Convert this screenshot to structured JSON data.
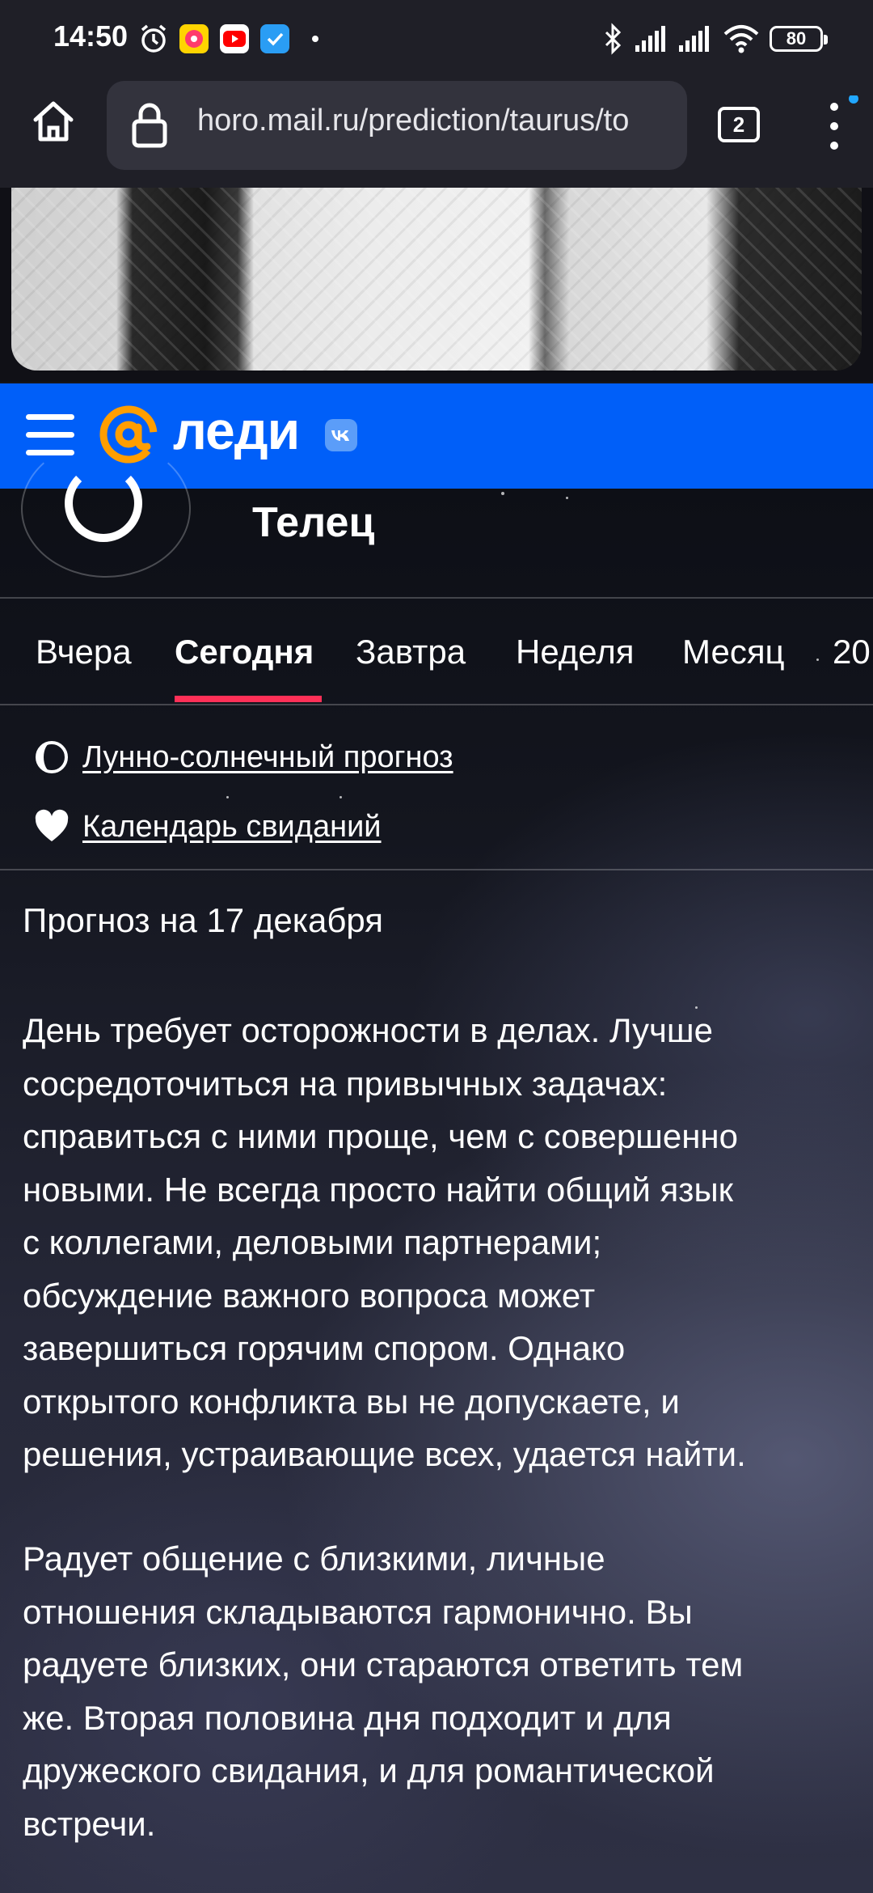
{
  "status_bar": {
    "time": "14:50",
    "battery": "80",
    "icons": [
      "alarm-icon",
      "music-app-icon",
      "youtube-icon",
      "task-app-icon",
      "dot-icon",
      "bluetooth-icon",
      "signal-icon",
      "signal-icon",
      "wifi-icon",
      "battery-icon"
    ]
  },
  "browser": {
    "url": "horo.mail.ru/prediction/taurus/to",
    "tab_count": "2"
  },
  "site_header": {
    "logo_text": "леди",
    "brand_color": "#005ff9"
  },
  "sign": {
    "title": "Телец"
  },
  "tabs": [
    {
      "label": "Вчера"
    },
    {
      "label": "Сегодня",
      "active": true
    },
    {
      "label": "Завтра"
    },
    {
      "label": "Неделя"
    },
    {
      "label": "Месяц"
    },
    {
      "label": "20"
    }
  ],
  "links": {
    "lunar": "Лунно-солнечный прогноз",
    "dating": "Календарь свиданий"
  },
  "forecast": {
    "date": "Прогноз на 17 декабря",
    "paragraph1_lines": [
      "День требует осторожности в делах. Лучше",
      "сосредоточиться на привычных задачах:",
      "справиться с ними проще, чем с совершенно",
      "новыми. Не всегда просто найти общий язык",
      "с коллегами, деловыми партнерами;",
      "обсуждение важного вопроса может",
      "завершиться горячим спором. Однако",
      "открытого конфликта вы не допускаете, и",
      "решения, устраивающие всех, удается найти."
    ],
    "paragraph2_lines": [
      "Радует общение с близкими, личные",
      "отношения складываются гармонично. Вы",
      "радуете близких, они стараются ответить тем",
      "же. Вторая половина дня подходит и для",
      "дружеского свидания, и для романтической",
      "встречи."
    ]
  },
  "colors": {
    "active_tab_underline": "#ff3057",
    "logo_orange": "#ff9e00"
  }
}
